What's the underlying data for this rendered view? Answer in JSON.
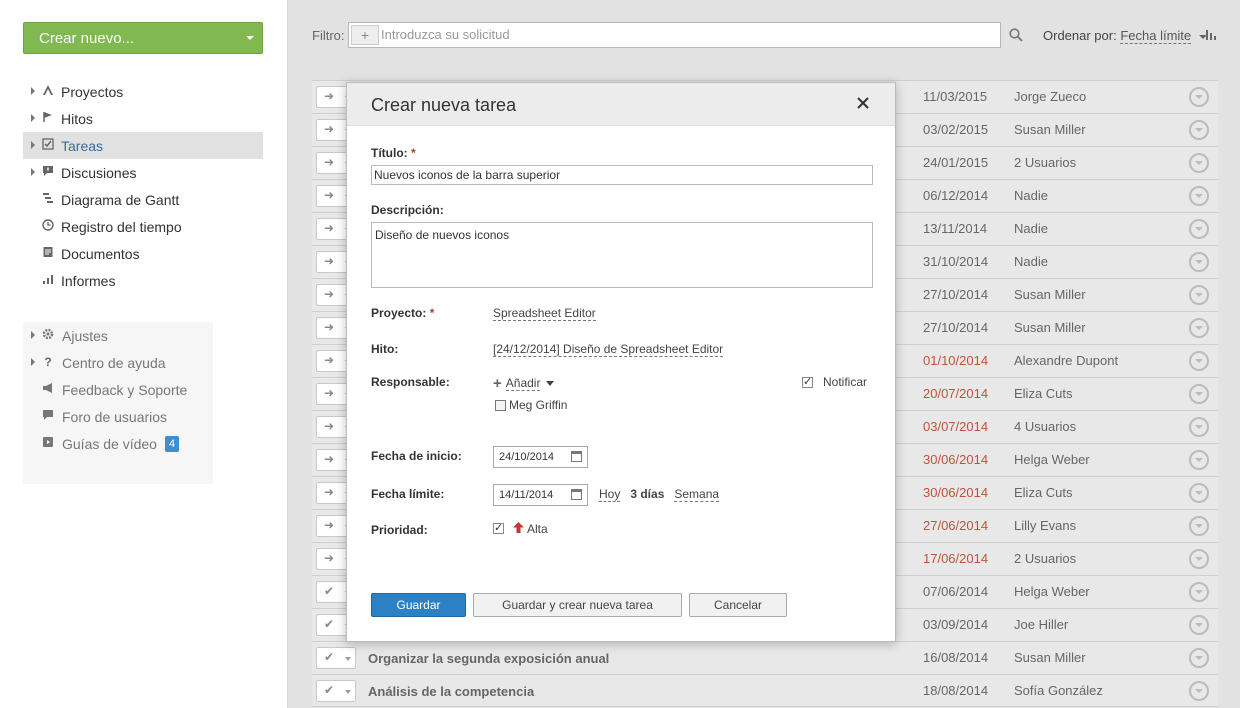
{
  "sidebar": {
    "create_button": "Crear nuevo...",
    "items": [
      {
        "label": "Proyectos",
        "icon": "projects-icon",
        "has_arrow": true
      },
      {
        "label": "Hitos",
        "icon": "flag-icon",
        "has_arrow": true
      },
      {
        "label": "Tareas",
        "icon": "tasks-icon",
        "has_arrow": true,
        "active": true
      },
      {
        "label": "Discusiones",
        "icon": "discussions-icon",
        "has_arrow": true
      },
      {
        "label": "Diagrama de Gantt",
        "icon": "gantt-icon",
        "has_arrow": false
      },
      {
        "label": "Registro del tiempo",
        "icon": "clock-icon",
        "has_arrow": false
      },
      {
        "label": "Documentos",
        "icon": "documents-icon",
        "has_arrow": false
      },
      {
        "label": "Informes",
        "icon": "reports-icon",
        "has_arrow": false
      }
    ],
    "secondary": [
      {
        "label": "Ajustes",
        "icon": "gear-icon",
        "has_arrow": true
      },
      {
        "label": "Centro de ayuda",
        "icon": "help-icon",
        "has_arrow": true
      },
      {
        "label": "Feedback y Soporte",
        "icon": "megaphone-icon",
        "has_arrow": false
      },
      {
        "label": "Foro de usuarios",
        "icon": "forum-icon",
        "has_arrow": false
      },
      {
        "label": "Guías de vídeo",
        "icon": "video-icon",
        "has_arrow": false,
        "badge": "4"
      }
    ]
  },
  "filter": {
    "label": "Filtro:",
    "placeholder": "Introduzca su solicitud",
    "sort_label": "Ordenar por:",
    "sort_value": "Fecha límite"
  },
  "tasks": [
    {
      "title": "",
      "date": "11/03/2015",
      "user": "Jorge Zueco",
      "overdue": false,
      "done": false
    },
    {
      "title": "",
      "date": "03/02/2015",
      "user": "Susan Miller",
      "overdue": false,
      "done": false
    },
    {
      "title": "",
      "date": "24/01/2015",
      "user": "2 Usuarios",
      "overdue": false,
      "done": false
    },
    {
      "title": "",
      "date": "06/12/2014",
      "user": "Nadie",
      "overdue": false,
      "done": false
    },
    {
      "title": "",
      "date": "13/11/2014",
      "user": "Nadie",
      "overdue": false,
      "done": false
    },
    {
      "title": "",
      "date": "31/10/2014",
      "user": "Nadie",
      "overdue": false,
      "done": false
    },
    {
      "title": "",
      "date": "27/10/2014",
      "user": "Susan Miller",
      "overdue": false,
      "done": false
    },
    {
      "title": "",
      "date": "27/10/2014",
      "user": "Susan Miller",
      "overdue": false,
      "done": false
    },
    {
      "title": "",
      "date": "01/10/2014",
      "user": "Alexandre Dupont",
      "overdue": true,
      "done": false
    },
    {
      "title": "",
      "date": "20/07/2014",
      "user": "Eliza Cuts",
      "overdue": true,
      "done": false
    },
    {
      "title": "",
      "date": "03/07/2014",
      "user": "4 Usuarios",
      "overdue": true,
      "done": false
    },
    {
      "title": "",
      "date": "30/06/2014",
      "user": "Helga Weber",
      "overdue": true,
      "done": false
    },
    {
      "title": "",
      "date": "30/06/2014",
      "user": "Eliza Cuts",
      "overdue": true,
      "done": false
    },
    {
      "title": "",
      "date": "27/06/2014",
      "user": "Lilly Evans",
      "overdue": true,
      "done": false
    },
    {
      "title": "",
      "date": "17/06/2014",
      "user": "2 Usuarios",
      "overdue": true,
      "done": false
    },
    {
      "title": "",
      "date": "07/06/2014",
      "user": "Helga Weber",
      "overdue": false,
      "done": true
    },
    {
      "title": "",
      "date": "03/09/2014",
      "user": "Joe Hiller",
      "overdue": false,
      "done": true
    },
    {
      "title": "Organizar la segunda exposición anual",
      "date": "16/08/2014",
      "user": "Susan Miller",
      "overdue": false,
      "done": true
    },
    {
      "title": "Análisis de la competencia",
      "date": "18/08/2014",
      "user": "Sofía González",
      "overdue": false,
      "done": true
    }
  ],
  "modal": {
    "title": "Crear nueva tarea",
    "title_label": "Título:",
    "title_value": "Nuevos iconos de la barra superior",
    "description_label": "Descripción:",
    "description_value": "Diseño de nuevos iconos",
    "project_label": "Proyecto:",
    "project_value": "Spreadsheet Editor",
    "milestone_label": "Hito:",
    "milestone_value": "[24/12/2014] Diseño de Spreadsheet Editor",
    "responsible_label": "Responsable:",
    "add_label": "Añadir",
    "responsible_person": "Meg Griffin",
    "notify_label": "Notificar",
    "start_label": "Fecha de inicio:",
    "start_value": "24/10/2014",
    "due_label": "Fecha límite:",
    "due_value": "14/11/2014",
    "quick_today": "Hoy",
    "quick_3days": "3 días",
    "quick_week": "Semana",
    "priority_label": "Prioridad:",
    "priority_value": "Alta",
    "save_button": "Guardar",
    "save_new_button": "Guardar y crear nueva tarea",
    "cancel_button": "Cancelar"
  }
}
